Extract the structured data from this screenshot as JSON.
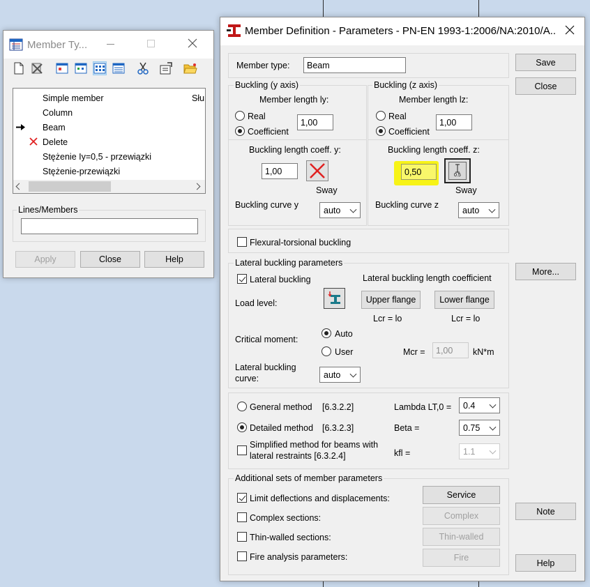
{
  "colors": {
    "desktop": "#c9d9ec",
    "highlight": "#f7f317",
    "danger": "#e02020",
    "toolbar_blue": "#1f66c2"
  },
  "member_types_window": {
    "title": "Member Ty...",
    "toolbar_icons": [
      "new-icon",
      "delete-icon",
      "view-icon-1",
      "view-icon-2",
      "view-icon-3",
      "view-icon-4",
      "cut-icon",
      "properties-icon",
      "open-folder-icon"
    ],
    "list_items": [
      {
        "label": "Simple member",
        "marker": "",
        "right_label": "Słu"
      },
      {
        "label": "Column",
        "marker": ""
      },
      {
        "label": "Beam",
        "marker": "arrow"
      },
      {
        "label": "Delete",
        "marker": "x"
      },
      {
        "label": "Stężenie Iy=0,5 - przewiązki",
        "marker": ""
      },
      {
        "label": "Stężenie-przewiązki",
        "marker": ""
      }
    ],
    "lines_members_label": "Lines/Members",
    "lines_members_value": "",
    "buttons": {
      "apply": "Apply",
      "close": "Close",
      "help": "Help"
    }
  },
  "member_definition": {
    "title": "Member Definition - Parameters - PN-EN 1993-1:2006/NA:2010/A...",
    "member_type_label": "Member type:",
    "member_type_value": "Beam",
    "buckling_y": {
      "group": "Buckling (y axis)",
      "length_label": "Member length ly:",
      "real": "Real",
      "coefficient": "Coefficient",
      "value": "1,00",
      "coeff_label": "Buckling length coeff. y:",
      "coeff_value": "1,00",
      "sway": "Sway",
      "curve_label": "Buckling curve y",
      "curve_value": "auto"
    },
    "buckling_z": {
      "group": "Buckling (z axis)",
      "length_label": "Member length lz:",
      "real": "Real",
      "coefficient": "Coefficient",
      "value": "1,00",
      "coeff_label": "Buckling length coeff. z:",
      "coeff_value": "0,50",
      "icon_text": "0.5",
      "sway": "Sway",
      "curve_label": "Buckling curve z",
      "curve_value": "auto"
    },
    "flexural_torsional": "Flexural-torsional buckling",
    "lateral": {
      "group": "Lateral buckling parameters",
      "lateral_buckling": "Lateral buckling",
      "length_coeff_label": "Lateral buckling length coefficient",
      "load_level": "Load level:",
      "upper_flange": "Upper flange",
      "lower_flange": "Lower flange",
      "lcr_upper": "Lcr =  lo",
      "lcr_lower": "Lcr =  lo",
      "critical_moment": "Critical moment:",
      "auto": "Auto",
      "user": "User",
      "mcr_label": "Mcr =",
      "mcr_value": "1,00",
      "mcr_unit": "kN*m",
      "curve_label_1": "Lateral buckling",
      "curve_label_2": "curve:",
      "curve_value": "auto"
    },
    "methods": {
      "general": "General method",
      "general_ref": "[6.3.2.2]",
      "detailed": "Detailed method",
      "detailed_ref": "[6.3.2.3]",
      "simplified_1": "Simplified method for beams with",
      "simplified_2": "lateral restraints [6.3.2.4]",
      "lambda_label": "Lambda LT,0 =",
      "lambda_value": "0.4",
      "beta_label": "Beta =",
      "beta_value": "0.75",
      "kfl_label": "kfl =",
      "kfl_value": "1.1"
    },
    "additional": {
      "group": "Additional sets of member parameters",
      "limit": "Limit deflections and displacements:",
      "complex": "Complex sections:",
      "thin": "Thin-walled sections:",
      "fire": "Fire analysis parameters:",
      "service_btn": "Service",
      "complex_btn": "Complex",
      "thin_btn": "Thin-walled",
      "fire_btn": "Fire"
    },
    "buttons": {
      "save": "Save",
      "close": "Close",
      "more": "More...",
      "note": "Note",
      "help": "Help"
    }
  }
}
